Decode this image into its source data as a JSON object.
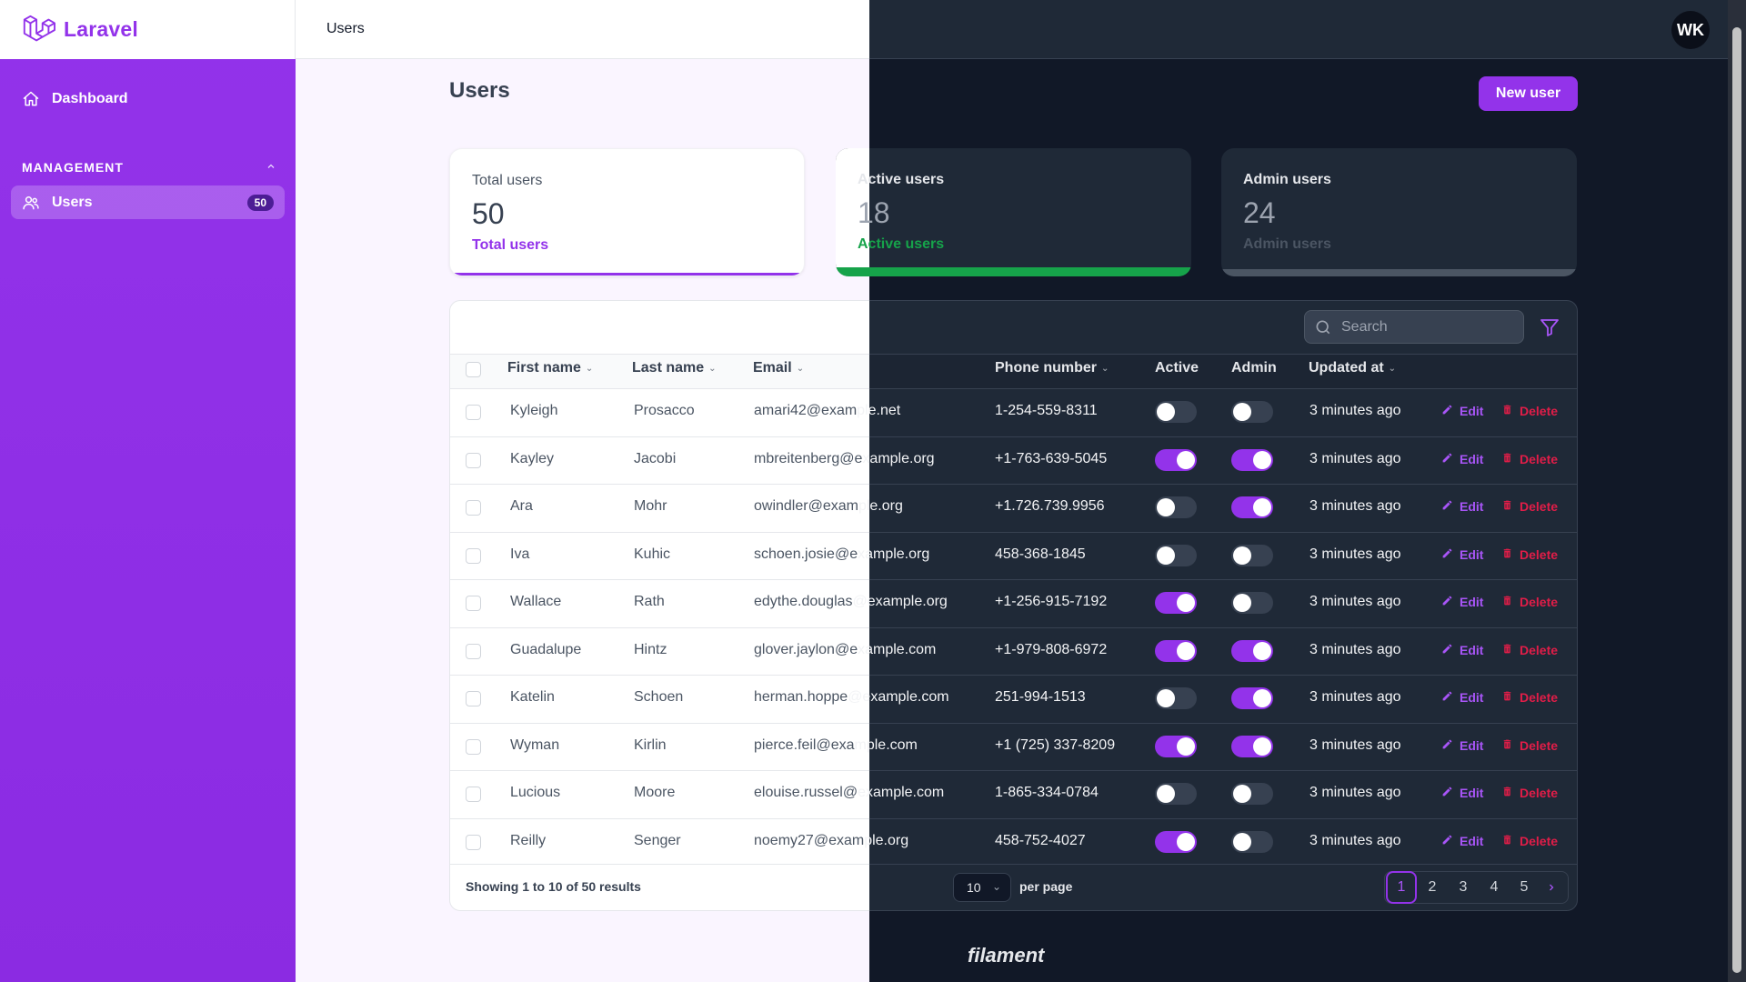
{
  "app": {
    "name": "Laravel"
  },
  "topbar": {
    "breadcrumb": "Users",
    "avatar_initials": "WK"
  },
  "sidebar": {
    "dashboard_label": "Dashboard",
    "group_label": "MANAGEMENT",
    "users_label": "Users",
    "users_badge": "50"
  },
  "page": {
    "title": "Users",
    "new_button": "New user"
  },
  "stats": [
    {
      "label": "Total users",
      "value": "50",
      "description": "Total users",
      "color": "#9333ea"
    },
    {
      "label": "Active users",
      "value": "18",
      "description": "Active users",
      "color": "#16a34a"
    },
    {
      "label": "Admin users",
      "value": "24",
      "description": "Admin users",
      "color": "#6b7280"
    }
  ],
  "table": {
    "search_placeholder": "Search",
    "columns": [
      "First name",
      "Last name",
      "Email",
      "Phone number",
      "Active",
      "Admin",
      "Updated at"
    ],
    "edit_label": "Edit",
    "delete_label": "Delete",
    "rows": [
      {
        "first": "Kyleigh",
        "last": "Prosacco",
        "email_a": "amari42@exam",
        "email_b": "ple.net",
        "phone": "1-254-559-8311",
        "active": false,
        "admin": false,
        "updated": "3 minutes ago"
      },
      {
        "first": "Kayley",
        "last": "Jacobi",
        "email_a": "mbreitenberg@e",
        "email_b": "xample.org",
        "phone": "+1-763-639-5045",
        "active": true,
        "admin": true,
        "updated": "3 minutes ago"
      },
      {
        "first": "Ara",
        "last": "Mohr",
        "email_a": "owindler@exam",
        "email_b": "ple.org",
        "phone": "+1.726.739.9956",
        "active": false,
        "admin": true,
        "updated": "3 minutes ago"
      },
      {
        "first": "Iva",
        "last": "Kuhic",
        "email_a": "schoen.josie@e",
        "email_b": "xample.org",
        "phone": "458-368-1845",
        "active": false,
        "admin": false,
        "updated": "3 minutes ago"
      },
      {
        "first": "Wallace",
        "last": "Rath",
        "email_a": "edythe.douglas",
        "email_b": "@example.org",
        "phone": "+1-256-915-7192",
        "active": true,
        "admin": false,
        "updated": "3 minutes ago"
      },
      {
        "first": "Guadalupe",
        "last": "Hintz",
        "email_a": "glover.jaylon@e",
        "email_b": "xample.com",
        "phone": "+1-979-808-6972",
        "active": true,
        "admin": true,
        "updated": "3 minutes ago"
      },
      {
        "first": "Katelin",
        "last": "Schoen",
        "email_a": "herman.hoppe",
        "email_b": "@example.com",
        "phone": "251-994-1513",
        "active": false,
        "admin": true,
        "updated": "3 minutes ago"
      },
      {
        "first": "Wyman",
        "last": "Kirlin",
        "email_a": "pierce.feil@exa",
        "email_b": "mple.com",
        "phone": "+1 (725) 337-8209",
        "active": true,
        "admin": true,
        "updated": "3 minutes ago"
      },
      {
        "first": "Lucious",
        "last": "Moore",
        "email_a": "elouise.russel@",
        "email_b": "example.com",
        "phone": "1-865-334-0784",
        "active": false,
        "admin": false,
        "updated": "3 minutes ago"
      },
      {
        "first": "Reilly",
        "last": "Senger",
        "email_a": "noemy27@exam",
        "email_b": "ple.org",
        "phone": "458-752-4027",
        "active": true,
        "admin": false,
        "updated": "3 minutes ago"
      }
    ],
    "showing": "Showing 1 to 10 of 50 results",
    "per_page_value": "10",
    "per_page_label": "per page",
    "pages": [
      "1",
      "2",
      "3",
      "4",
      "5"
    ],
    "current_page": "1"
  },
  "footer": {
    "brand": "filament"
  },
  "colors": {
    "primary": "#9333ea",
    "success": "#16a34a",
    "danger": "#e11d48",
    "dark_bg": "#111827",
    "dark_panel": "#1f2937"
  }
}
